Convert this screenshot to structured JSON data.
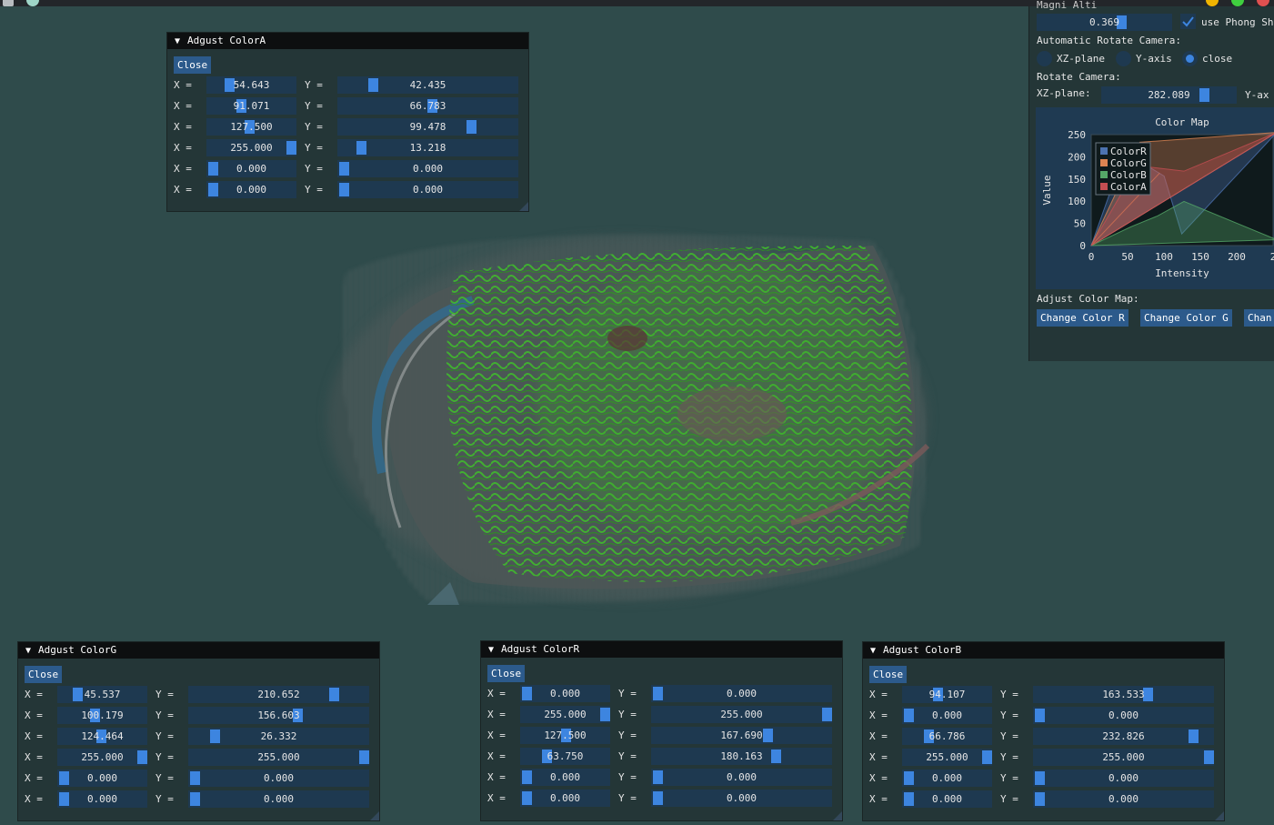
{
  "window_controls": {
    "left": [
      "close",
      "min"
    ],
    "right": [
      "yellow",
      "green",
      "red"
    ]
  },
  "right_panel": {
    "top_value": "0.369",
    "phong_label": "use Phong Sh",
    "phong_checked": true,
    "auto_rotate_label": "Automatic Rotate Camera:",
    "auto_rotate_options": [
      "XZ-plane",
      "Y-axis",
      "close"
    ],
    "auto_rotate_selected": 2,
    "rotate_label": "Rotate Camera:",
    "xz_plane_label": "XZ-plane:",
    "xz_plane_value": "282.089",
    "xz_plane_fraction": 0.78,
    "y_axis_label": "Y-ax",
    "adjust_label": "Adjust Color Map:",
    "buttons": [
      "Change Color R",
      "Change Color G",
      "Chan"
    ]
  },
  "chart_data": {
    "type": "area",
    "title": "Color Map",
    "xlabel": "Intensity",
    "ylabel": "Value",
    "xlim": [
      0,
      250
    ],
    "ylim": [
      0,
      250
    ],
    "x_ticks": [
      "0",
      "50",
      "100",
      "150",
      "200",
      "2"
    ],
    "y_ticks": [
      "250",
      "200",
      "150",
      "100",
      "50",
      "0"
    ],
    "legend_position": "top-left",
    "series": [
      {
        "name": "ColorR",
        "color": "#4c72b0",
        "points": [
          [
            0,
            0
          ],
          [
            45.537,
            210.652
          ],
          [
            100.179,
            156.603
          ],
          [
            124.464,
            26.332
          ],
          [
            255,
            255
          ]
        ]
      },
      {
        "name": "ColorG",
        "color": "#dd8452",
        "points": [
          [
            0,
            0
          ],
          [
            94.107,
            163.533
          ],
          [
            0,
            0
          ],
          [
            66.786,
            232.826
          ],
          [
            255,
            255
          ]
        ]
      },
      {
        "name": "ColorB",
        "color": "#55a868",
        "points": [
          [
            0,
            0
          ],
          [
            54.643,
            42.435
          ],
          [
            91.071,
            66.783
          ],
          [
            127.5,
            99.478
          ],
          [
            255,
            13.218
          ]
        ]
      },
      {
        "name": "ColorA",
        "color": "#c44e52",
        "points": [
          [
            0,
            0
          ],
          [
            255,
            255
          ],
          [
            127.5,
            167.69
          ],
          [
            63.75,
            180.163
          ]
        ]
      }
    ]
  },
  "panels": [
    {
      "id": "colorA",
      "title": "Adgust ColorA",
      "close": "Close",
      "rows": [
        {
          "x": "54.643",
          "xf": 0.21,
          "y": "42.435",
          "yf": 0.17
        },
        {
          "x": "91.071",
          "xf": 0.36,
          "y": "66.783",
          "yf": 0.52
        },
        {
          "x": "127.500",
          "xf": 0.47,
          "y": "99.478",
          "yf": 0.75
        },
        {
          "x": "255.000",
          "xf": 1.0,
          "y": "13.218",
          "yf": 0.1
        },
        {
          "x": "0.000",
          "xf": 0.0,
          "y": "0.000",
          "yf": 0.0
        },
        {
          "x": "0.000",
          "xf": 0.0,
          "y": "0.000",
          "yf": 0.0
        }
      ]
    },
    {
      "id": "colorG",
      "title": "Adgust ColorG",
      "close": "Close",
      "rows": [
        {
          "x": "45.537",
          "xf": 0.18,
          "y": "210.652",
          "yf": 0.82
        },
        {
          "x": "100.179",
          "xf": 0.39,
          "y": "156.603",
          "yf": 0.61
        },
        {
          "x": "124.464",
          "xf": 0.48,
          "y": "26.332",
          "yf": 0.12
        },
        {
          "x": "255.000",
          "xf": 1.0,
          "y": "255.000",
          "yf": 1.0
        },
        {
          "x": "0.000",
          "xf": 0.0,
          "y": "0.000",
          "yf": 0.0
        },
        {
          "x": "0.000",
          "xf": 0.0,
          "y": "0.000",
          "yf": 0.0
        }
      ]
    },
    {
      "id": "colorR",
      "title": "Adgust ColorR",
      "close": "Close",
      "rows": [
        {
          "x": "0.000",
          "xf": 0.0,
          "y": "0.000",
          "yf": 0.0
        },
        {
          "x": "255.000",
          "xf": 1.0,
          "y": "255.000",
          "yf": 1.0
        },
        {
          "x": "127.500",
          "xf": 0.5,
          "y": "167.690",
          "yf": 0.65
        },
        {
          "x": "63.750",
          "xf": 0.25,
          "y": "180.163",
          "yf": 0.7
        },
        {
          "x": "0.000",
          "xf": 0.0,
          "y": "0.000",
          "yf": 0.0
        },
        {
          "x": "0.000",
          "xf": 0.0,
          "y": "0.000",
          "yf": 0.0
        }
      ]
    },
    {
      "id": "colorB",
      "title": "Adgust ColorB",
      "close": "Close",
      "rows": [
        {
          "x": "94.107",
          "xf": 0.37,
          "y": "163.533",
          "yf": 0.64
        },
        {
          "x": "0.000",
          "xf": 0.0,
          "y": "0.000",
          "yf": 0.0
        },
        {
          "x": "66.786",
          "xf": 0.26,
          "y": "232.826",
          "yf": 0.91
        },
        {
          "x": "255.000",
          "xf": 1.0,
          "y": "255.000",
          "yf": 1.0
        },
        {
          "x": "0.000",
          "xf": 0.0,
          "y": "0.000",
          "yf": 0.0
        },
        {
          "x": "0.000",
          "xf": 0.0,
          "y": "0.000",
          "yf": 0.0
        }
      ]
    }
  ],
  "labels": {
    "x": "X =",
    "y": "Y ="
  }
}
